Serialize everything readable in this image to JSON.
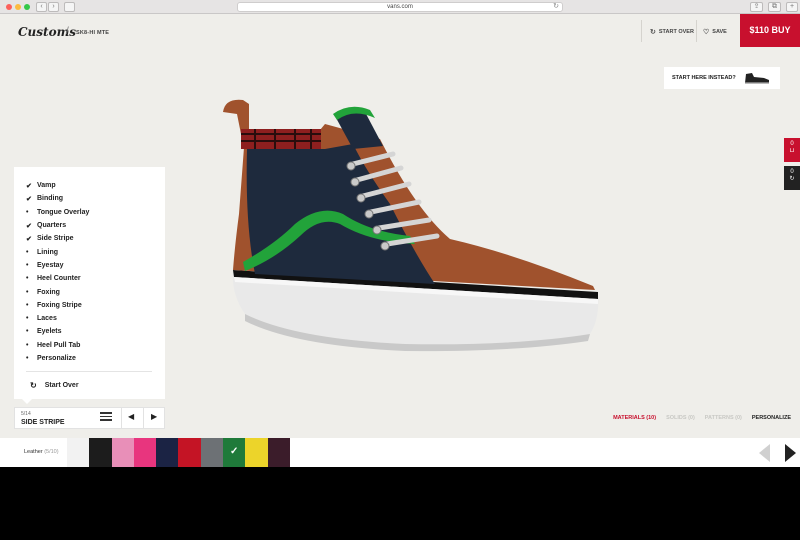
{
  "browser": {
    "url": "vans.com",
    "back_glyph": "‹",
    "forward_glyph": "›",
    "reload_glyph": "↻",
    "share_glyph": "⇪",
    "tabs_glyph": "⧉",
    "new_tab_glyph": "+"
  },
  "header": {
    "brand": "Customs",
    "separator": "/",
    "model": "SK8-HI MTE",
    "start_over_label": "START OVER",
    "save_label": "SAVE",
    "start_over_icon": "↻",
    "save_icon": "♡",
    "buy_label": "$110 BUY"
  },
  "start_here": {
    "label": "START HERE INSTEAD?"
  },
  "side_tabs": [
    {
      "count": "0",
      "icon": "cart-icon",
      "glyph": "🛒",
      "color": "#c8102e"
    },
    {
      "count": "0",
      "icon": "share-icon",
      "glyph": "⟳",
      "color": "#222222"
    }
  ],
  "parts": [
    {
      "label": "Vamp",
      "done": true
    },
    {
      "label": "Binding",
      "done": true
    },
    {
      "label": "Tongue Overlay",
      "done": false
    },
    {
      "label": "Quarters",
      "done": true
    },
    {
      "label": "Side Stripe",
      "done": true
    },
    {
      "label": "Lining",
      "done": false
    },
    {
      "label": "Eyestay",
      "done": false
    },
    {
      "label": "Heel Counter",
      "done": false
    },
    {
      "label": "Foxing",
      "done": false
    },
    {
      "label": "Foxing Stripe",
      "done": false
    },
    {
      "label": "Laces",
      "done": false
    },
    {
      "label": "Eyelets",
      "done": false
    },
    {
      "label": "Heel Pull Tab",
      "done": false
    },
    {
      "label": "Personalize",
      "done": false
    }
  ],
  "panel": {
    "start_over_label": "Start Over",
    "start_over_icon": "↻"
  },
  "selector": {
    "count": "5/14",
    "name": "SIDE STRIPE",
    "prev_glyph": "◀",
    "next_glyph": "▶"
  },
  "filters": [
    {
      "label": "MATERIALS (10)",
      "state": "active"
    },
    {
      "label": "SOLIDS (0)",
      "state": "disabled"
    },
    {
      "label": "PATTERNS (0)",
      "state": "disabled"
    },
    {
      "label": "PERSONALIZE",
      "state": "dark"
    }
  ],
  "swatch_bar": {
    "label": "Leather",
    "count": "(5/10)",
    "check_glyph": "✓",
    "colors": [
      {
        "hex": "#f2f2f2",
        "selected": false
      },
      {
        "hex": "#1c1c1c",
        "selected": false
      },
      {
        "hex": "#e88fb8",
        "selected": false
      },
      {
        "hex": "#e8357e",
        "selected": false
      },
      {
        "hex": "#1b2344",
        "selected": false
      },
      {
        "hex": "#c41425",
        "selected": false
      },
      {
        "hex": "#6d7175",
        "selected": false
      },
      {
        "hex": "#1f7a3a",
        "selected": true
      },
      {
        "hex": "#ecd42a",
        "selected": false
      },
      {
        "hex": "#3b1c2a",
        "selected": false
      }
    ]
  },
  "shoe_colors": {
    "suede": "#a0522d",
    "canvas": "#1e2a3d",
    "stripe": "#22a33a",
    "sole": "#e9e9e9",
    "plaid": "#8e1f1f"
  }
}
